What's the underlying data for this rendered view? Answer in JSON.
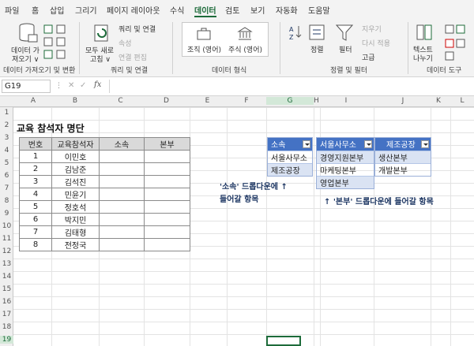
{
  "tabs": [
    "파일",
    "홈",
    "삽입",
    "그리기",
    "페이지 레이아웃",
    "수식",
    "데이터",
    "검토",
    "보기",
    "자동화",
    "도움말"
  ],
  "ribbon": {
    "get_data_line1": "데이터 가",
    "get_data_line2": "져오기 ∨",
    "group_get": "데이터 가져오기 및 변환",
    "refresh_line1": "모두 새로",
    "refresh_line2": "고침 ∨",
    "queries_connections": "쿼리 및 연결",
    "properties": "속성",
    "edit_links": "연결 편집",
    "group_queries": "쿼리 및 연결",
    "datatype_org": "조직 (영어)",
    "datatype_stock": "주식 (영어)",
    "group_datatypes": "데이터 형식",
    "sort": "정렬",
    "filter": "필터",
    "clear": "지우기",
    "reapply": "다시 적용",
    "advanced": "고급",
    "group_sort": "정렬 및 필터",
    "text_to_columns_line1": "텍스트",
    "text_to_columns_line2": "나누기",
    "group_tools": "데이터 도구"
  },
  "formula_bar": {
    "name_box": "G19",
    "fx": "fx"
  },
  "columns": [
    "A",
    "B",
    "C",
    "D",
    "E",
    "F",
    "G",
    "H",
    "I",
    "J",
    "K",
    "L"
  ],
  "rows": [
    "1",
    "2",
    "3",
    "4",
    "5",
    "6",
    "7",
    "8",
    "9",
    "10",
    "11",
    "12",
    "13",
    "14",
    "15",
    "16",
    "17",
    "18",
    "19"
  ],
  "sheet": {
    "title": "교육 참석자 명단",
    "headers": [
      "번호",
      "교육참석자",
      "소속",
      "본부"
    ],
    "rows": [
      [
        "1",
        "이민호",
        "",
        ""
      ],
      [
        "2",
        "김남준",
        "",
        ""
      ],
      [
        "3",
        "김석진",
        "",
        ""
      ],
      [
        "4",
        "민윤기",
        "",
        ""
      ],
      [
        "5",
        "정호석",
        "",
        ""
      ],
      [
        "6",
        "박지민",
        "",
        ""
      ],
      [
        "7",
        "김태형",
        "",
        ""
      ],
      [
        "8",
        "전정국",
        "",
        ""
      ]
    ]
  },
  "list_sosok": {
    "header": "소속",
    "items": [
      "서울사무소",
      "제조공장"
    ]
  },
  "list_seoul": {
    "header": "서울사무소",
    "items": [
      "경영지원본부",
      "마케팅본부",
      "영업본부"
    ]
  },
  "list_factory": {
    "header": "제조공장",
    "items": [
      "생산본부",
      "개발본부"
    ]
  },
  "notes": {
    "sosok_line1": "'소속' 드롭다운에 ↑",
    "sosok_line2": "들어갈 항목",
    "bonbu": "↑ '본부' 드롭다운에 들어갈 항목"
  },
  "colors": {
    "accent": "#1d6b3a",
    "table_header": "#4472c4",
    "band": "#dae3f3",
    "note": "#1f3864"
  }
}
